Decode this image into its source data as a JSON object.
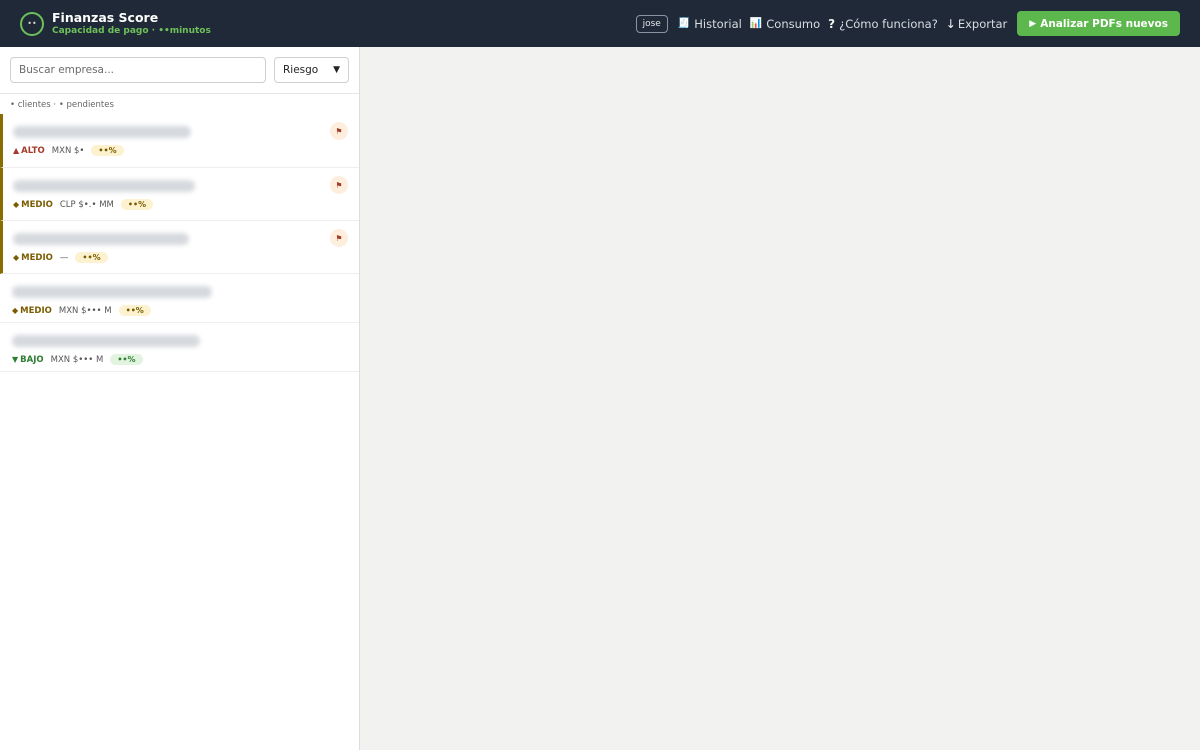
{
  "header": {
    "logo_text": "••",
    "title": "Finanzas Score",
    "subtitle": "Capacidad de pago · ••minutos",
    "user": "jose",
    "nav": [
      {
        "icon": "🧾",
        "label": "Historial"
      },
      {
        "icon": "📊",
        "label": "Consumo"
      },
      {
        "icon": "?",
        "label": "¿Cómo funciona?"
      },
      {
        "icon": "↓",
        "label": "Exportar"
      }
    ],
    "primary_button": {
      "icon": "▶",
      "label": "Analizar PDFs nuevos"
    }
  },
  "sidebar": {
    "search_placeholder": "Buscar empresa...",
    "sort_value": "Riesgo",
    "counts": "• clientes · • pendientes",
    "items": [
      {
        "risk_glyph": "▲",
        "risk": "ALTO",
        "amount": "MXN $•",
        "pct": "••%",
        "flag": "⚑"
      },
      {
        "risk_glyph": "◆",
        "risk": "MEDIO",
        "amount": "CLP $•.• MM",
        "pct": "••%",
        "flag": "⚑"
      },
      {
        "risk_glyph": "◆",
        "risk": "MEDIO",
        "amount": "—",
        "pct": "••%",
        "flag": "⚑"
      },
      {
        "risk_glyph": "◆",
        "risk": "MEDIO",
        "amount": "MXN $••• M",
        "pct": "••%"
      },
      {
        "risk_glyph": "▼",
        "risk": "BAJO",
        "amount": "MXN $••• M",
        "pct": "••%"
      }
    ]
  },
  "colors": {
    "header_bg": "#1f2937",
    "accent_green": "#5cb84c",
    "risk_high": "#a33a2a",
    "risk_medium": "#7a5c00",
    "risk_low": "#2e7d32"
  }
}
